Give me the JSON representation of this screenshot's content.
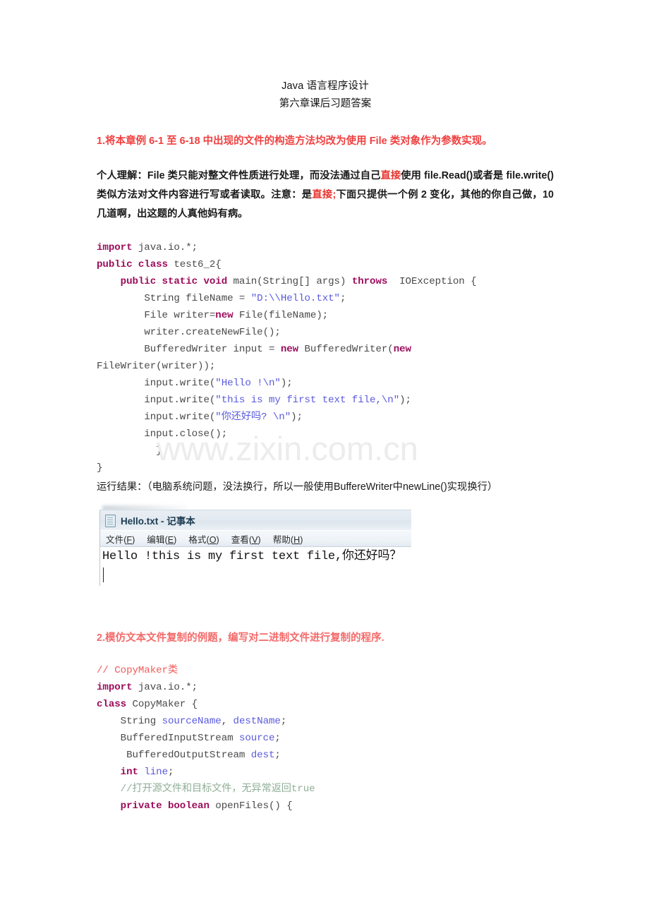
{
  "document": {
    "title": "Java 语言程序设计",
    "subtitle": "第六章课后习题答案",
    "watermark": "www.zixin.com.cn"
  },
  "question1": {
    "heading": "1.将本章例 6-1 至 6-18 中出现的文件的构造方法均改为使用 File 类对象作为参数实现。",
    "paragraph": {
      "seg1": "个人理解：File 类只能对整文件性质进行处理，而没法通过自己",
      "seg2_red": "直接",
      "seg3": "使用 file.Read()或者是 file.write()类似方法对文件内容进行写或者读取。注意：是",
      "seg4_red": "直接;",
      "seg5": "下面只提供一个例 2 变化，其他的你自己做，10 几道啊，出这题的人真他妈有病。"
    },
    "code_lines": [
      {
        "indent": 0,
        "tokens": [
          {
            "t": "kw",
            "v": "import"
          },
          {
            "t": "pl",
            "v": " java.io.*;"
          }
        ]
      },
      {
        "indent": 0,
        "tokens": [
          {
            "t": "kw",
            "v": "public class"
          },
          {
            "t": "pl",
            "v": " test6_2{"
          }
        ]
      },
      {
        "indent": 1,
        "tokens": [
          {
            "t": "kw",
            "v": "public static void"
          },
          {
            "t": "pl",
            "v": " main(String[] args) "
          },
          {
            "t": "kw",
            "v": "throws"
          },
          {
            "t": "pl",
            "v": "  IOException {"
          }
        ]
      },
      {
        "indent": 2,
        "tokens": [
          {
            "t": "pl",
            "v": "String fileName = "
          },
          {
            "t": "str",
            "v": "\"D:\\\\Hello.txt\""
          },
          {
            "t": "pl",
            "v": ";"
          }
        ]
      },
      {
        "indent": 2,
        "tokens": [
          {
            "t": "pl",
            "v": "File writer="
          },
          {
            "t": "kw",
            "v": "new"
          },
          {
            "t": "pl",
            "v": " File(fileName);"
          }
        ]
      },
      {
        "indent": 2,
        "tokens": [
          {
            "t": "pl",
            "v": "writer.createNewFile();"
          }
        ]
      },
      {
        "indent": 2,
        "tokens": [
          {
            "t": "pl",
            "v": "BufferedWriter input = "
          },
          {
            "t": "kw",
            "v": "new"
          },
          {
            "t": "pl",
            "v": " BufferedWriter("
          },
          {
            "t": "kw",
            "v": "new"
          }
        ]
      },
      {
        "indent": 0,
        "tokens": [
          {
            "t": "pl",
            "v": "FileWriter(writer));"
          }
        ]
      },
      {
        "indent": 2,
        "tokens": [
          {
            "t": "pl",
            "v": "input.write("
          },
          {
            "t": "str",
            "v": "\"Hello !\\n\""
          },
          {
            "t": "pl",
            "v": ");"
          }
        ]
      },
      {
        "indent": 2,
        "tokens": [
          {
            "t": "pl",
            "v": "input.write("
          },
          {
            "t": "str",
            "v": "\"this is my first text file,\\n\""
          },
          {
            "t": "pl",
            "v": ");"
          }
        ]
      },
      {
        "indent": 2,
        "tokens": [
          {
            "t": "pl",
            "v": "input.write("
          },
          {
            "t": "str",
            "v": "\"你还好吗? \\n\""
          },
          {
            "t": "pl",
            "v": ");"
          }
        ]
      },
      {
        "indent": 2,
        "tokens": [
          {
            "t": "pl",
            "v": "input.close();"
          }
        ]
      },
      {
        "indent": 2,
        "tokens": [
          {
            "t": "pl",
            "v": "  }"
          }
        ]
      },
      {
        "indent": 0,
        "tokens": [
          {
            "t": "pl",
            "v": "}"
          }
        ]
      }
    ],
    "result_note": "运行结果：（电脑系统问题，没法换行，所以一般使用BuffereWriter中newLine()实现换行）"
  },
  "notepad": {
    "title": "Hello.txt - 记事本",
    "menus": [
      {
        "label": "文件",
        "accel": "F"
      },
      {
        "label": "编辑",
        "accel": "E"
      },
      {
        "label": "格式",
        "accel": "O"
      },
      {
        "label": "查看",
        "accel": "V"
      },
      {
        "label": "帮助",
        "accel": "H"
      }
    ],
    "content": "Hello !this is my first text file,你还好吗？"
  },
  "question2": {
    "heading": "2.模仿文本文件复制的例题，编写对二进制文件进行复制的程序.",
    "code_lines": [
      {
        "indent": 0,
        "tokens": [
          {
            "t": "cmt-red",
            "v": "// CopyMaker类"
          }
        ]
      },
      {
        "indent": 0,
        "tokens": [
          {
            "t": "kw",
            "v": "import"
          },
          {
            "t": "pl",
            "v": " java.io.*;"
          }
        ]
      },
      {
        "indent": 0,
        "tokens": [
          {
            "t": "kw",
            "v": "class"
          },
          {
            "t": "pl",
            "v": " CopyMaker {"
          }
        ]
      },
      {
        "indent": 1,
        "tokens": [
          {
            "t": "pl",
            "v": "String "
          },
          {
            "t": "var",
            "v": "sourceName"
          },
          {
            "t": "pl",
            "v": ", "
          },
          {
            "t": "var",
            "v": "destName"
          },
          {
            "t": "pl",
            "v": ";"
          }
        ]
      },
      {
        "indent": 1,
        "tokens": [
          {
            "t": "pl",
            "v": "BufferedInputStream "
          },
          {
            "t": "var",
            "v": "source"
          },
          {
            "t": "pl",
            "v": ";"
          }
        ]
      },
      {
        "indent": 1,
        "tokens": [
          {
            "t": "pl",
            "v": " BufferedOutputStream "
          },
          {
            "t": "var",
            "v": "dest"
          },
          {
            "t": "pl",
            "v": ";"
          }
        ]
      },
      {
        "indent": 1,
        "tokens": [
          {
            "t": "kw",
            "v": "int"
          },
          {
            "t": "pl",
            "v": " "
          },
          {
            "t": "var",
            "v": "line"
          },
          {
            "t": "pl",
            "v": ";"
          }
        ]
      },
      {
        "indent": 1,
        "tokens": [
          {
            "t": "cmt-green",
            "v": "//打开源文件和目标文件，无异常返回true"
          }
        ]
      },
      {
        "indent": 1,
        "tokens": [
          {
            "t": "kw",
            "v": "private boolean"
          },
          {
            "t": "pl",
            "v": " openFiles() {"
          }
        ]
      }
    ]
  },
  "colors": {
    "heading_red": "#f04040",
    "keyword": "#9c0d5c",
    "string": "#5a5ae0",
    "comment_green": "#8fae96",
    "comment_red": "#f25b5b",
    "code_plain": "#4a4a4a",
    "watermark": "#ececec"
  }
}
